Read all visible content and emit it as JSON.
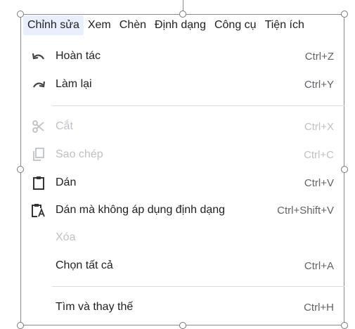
{
  "menubar": {
    "items": [
      {
        "label": "Chỉnh sửa",
        "active": true
      },
      {
        "label": "Xem"
      },
      {
        "label": "Chèn"
      },
      {
        "label": "Định dạng"
      },
      {
        "label": "Công cụ"
      },
      {
        "label": "Tiện ích"
      }
    ]
  },
  "edit_menu": {
    "items": [
      {
        "label": "Hoàn tác",
        "shortcut": "Ctrl+Z",
        "icon": "undo-icon",
        "enabled": true
      },
      {
        "label": "Làm lại",
        "shortcut": "Ctrl+Y",
        "icon": "redo-icon",
        "enabled": true
      },
      {
        "label": "Cắt",
        "shortcut": "Ctrl+X",
        "icon": "cut-icon",
        "enabled": false
      },
      {
        "label": "Sao chép",
        "shortcut": "Ctrl+C",
        "icon": "copy-icon",
        "enabled": false
      },
      {
        "label": "Dán",
        "shortcut": "Ctrl+V",
        "icon": "paste-icon",
        "enabled": true
      },
      {
        "label": "Dán mà không áp dụng định dạng",
        "shortcut": "Ctrl+Shift+V",
        "icon": "paste-plain-icon",
        "enabled": true
      },
      {
        "label": "Xóa",
        "shortcut": "",
        "icon": "",
        "enabled": false
      },
      {
        "label": "Chọn tất cả",
        "shortcut": "Ctrl+A",
        "icon": "",
        "enabled": true
      },
      {
        "label": "Tìm và thay thế",
        "shortcut": "Ctrl+H",
        "icon": "",
        "enabled": true
      }
    ]
  },
  "colors": {
    "disabled": "#bdc1c6",
    "active_bg": "#e8f0fe",
    "text": "#202124",
    "shortcut": "#5f6368"
  }
}
